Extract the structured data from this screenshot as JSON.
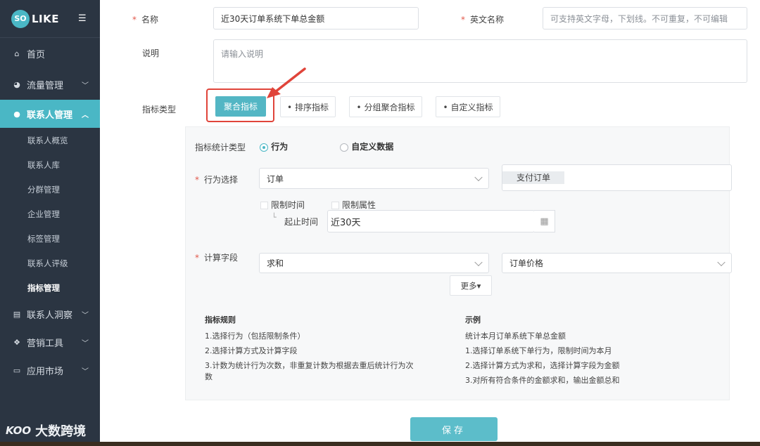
{
  "sidebar": {
    "logo_mark": "SO",
    "logo_text": "LIKE",
    "menu_toggle_glyph": "☰",
    "items": [
      {
        "label": "首页",
        "icon": "home-icon"
      },
      {
        "label": "流量管理",
        "icon": "pie-chart-icon"
      },
      {
        "label": "联系人管理",
        "icon": "users-icon"
      },
      {
        "label": "联系人洞察",
        "icon": "id-card-icon"
      },
      {
        "label": "营销工具",
        "icon": "cubes-icon"
      },
      {
        "label": "应用市场",
        "icon": "cart-icon"
      }
    ],
    "sub_items": [
      "联系人概览",
      "联系人库",
      "分群管理",
      "企业管理",
      "标签管理",
      "联系人评级",
      "指标管理"
    ],
    "active_color": "#4ab7c5"
  },
  "form": {
    "name_label": "名称",
    "name_value": "近30天订单系统下单总金额",
    "en_name_label": "英文名称",
    "en_name_placeholder": "可支持英文字母，下划线。不可重复，不可编辑",
    "desc_label": "说明",
    "desc_placeholder": "请输入说明",
    "type_label": "指标类型",
    "types": [
      "聚合指标",
      "• 排序指标",
      "• 分组聚合指标",
      "• 自定义指标"
    ]
  },
  "panel": {
    "stat_type_label": "指标统计类型",
    "radio_behavior": "行为",
    "radio_custom": "自定义数据",
    "behavior_label": "行为选择",
    "behavior_value": "订单",
    "behavior_tag": "支付订单",
    "limit_time": "限制时间",
    "limit_attr": "限制属性",
    "range_label": "起止时间",
    "range_value": "近30天",
    "calc_label": "计算字段",
    "calc_value": "求和",
    "calc_field_value": "订单价格",
    "more_label": "更多▾",
    "rules_title": "指标规则",
    "rules": [
      "1.选择行为（包括限制条件）",
      "2.选择计算方式及计算字段",
      "3.计数为统计行为次数，非重复计数为根据去重后统计行为次",
      "数"
    ],
    "example_title": "示例",
    "examples": [
      "统计本月订单系统下单总金额",
      "1.选择订单系统下单行为，限制时间为本月",
      "2.选择计算方式为求和，选择计算字段为金额",
      "3.对所有符合条件的金额求和，输出金额总和"
    ]
  },
  "save_label": "保存",
  "watermark": {
    "mark": "KOO",
    "text": "大数跨境"
  },
  "colors": {
    "accent": "#53b6c4",
    "highlight": "#e0443a",
    "sidebar_bg": "#2b3542"
  }
}
